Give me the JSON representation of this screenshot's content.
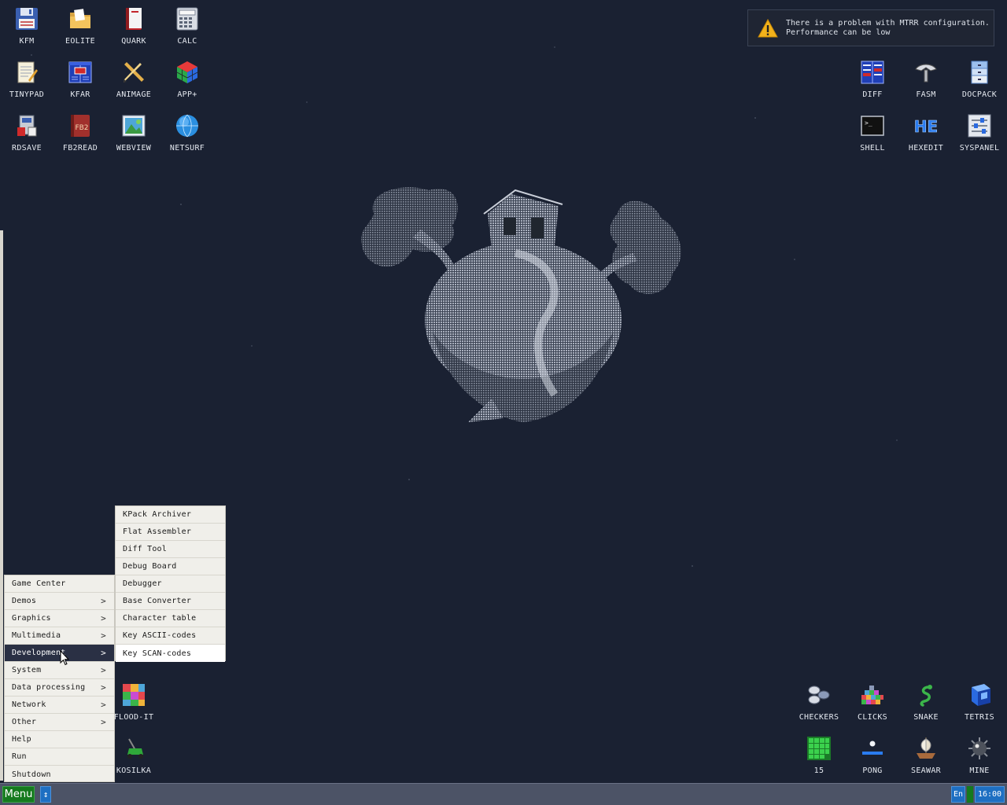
{
  "desktop": {
    "icons_top_left": [
      {
        "label": "KFM",
        "icon": "floppy-disk-icon"
      },
      {
        "label": "EOLITE",
        "icon": "folder-icon"
      },
      {
        "label": "QUARK",
        "icon": "red-book-icon"
      },
      {
        "label": "CALC",
        "icon": "calculator-icon"
      },
      {
        "label": "TINYPAD",
        "icon": "notepad-icon"
      },
      {
        "label": "KFAR",
        "icon": "blue-panels-icon"
      },
      {
        "label": "ANIMAGE",
        "icon": "pencil-ruler-icon"
      },
      {
        "label": "APP+",
        "icon": "cube-icon"
      },
      {
        "label": "RDSAVE",
        "icon": "save-drive-icon"
      },
      {
        "label": "FB2READ",
        "icon": "fb2-book-icon"
      },
      {
        "label": "WEBVIEW",
        "icon": "web-picture-icon"
      },
      {
        "label": "NETSURF",
        "icon": "globe-icon"
      }
    ],
    "icons_top_right": [
      {
        "label": "DIFF",
        "icon": "diff-icon"
      },
      {
        "label": "FASM",
        "icon": "fasm-icon"
      },
      {
        "label": "DOCPACK",
        "icon": "docpack-icon"
      },
      {
        "label": "SHELL",
        "icon": "terminal-icon"
      },
      {
        "label": "HEXEDIT",
        "icon": "hex-icon"
      },
      {
        "label": "SYSPANEL",
        "icon": "sliders-icon"
      }
    ],
    "icons_bottom_left": [
      {
        "label": "FLOOD-IT",
        "icon": "color-grid-icon"
      },
      {
        "label": "KOSILKA",
        "icon": "lawnmower-icon"
      }
    ],
    "icons_bottom_right": [
      {
        "label": "CHECKERS",
        "icon": "checkers-icon"
      },
      {
        "label": "CLICKS",
        "icon": "clicks-icon"
      },
      {
        "label": "SNAKE",
        "icon": "snake-icon"
      },
      {
        "label": "TETRIS",
        "icon": "tetris-icon"
      },
      {
        "label": "15",
        "icon": "puzzle15-icon"
      },
      {
        "label": "PONG",
        "icon": "pong-icon"
      },
      {
        "label": "SEAWAR",
        "icon": "ship-icon"
      },
      {
        "label": "MINE",
        "icon": "mine-icon"
      }
    ]
  },
  "notification": {
    "line1": "There is a problem with MTRR configuration.",
    "line2": "Performance can be low"
  },
  "main_menu": {
    "items": [
      {
        "label": "Game Center",
        "arrow": ""
      },
      {
        "label": "Demos",
        "arrow": ">"
      },
      {
        "label": "Graphics",
        "arrow": ">"
      },
      {
        "label": "Multimedia",
        "arrow": ">"
      },
      {
        "label": "Development",
        "arrow": ">"
      },
      {
        "label": "System",
        "arrow": ">"
      },
      {
        "label": "Data processing",
        "arrow": ">"
      },
      {
        "label": "Network",
        "arrow": ">"
      },
      {
        "label": "Other",
        "arrow": ">"
      },
      {
        "label": "Help",
        "arrow": ""
      },
      {
        "label": "Run",
        "arrow": ""
      },
      {
        "label": "Shutdown",
        "arrow": ""
      }
    ]
  },
  "sub_menu": {
    "items": [
      "KPack Archiver",
      "Flat Assembler",
      "Diff Tool",
      "Debug Board",
      "Debugger",
      "Base Converter",
      "Character table",
      "Key ASCII-codes",
      "Key SCAN-codes"
    ]
  },
  "taskbar": {
    "menu_label": "Menu",
    "switch_glyph": "↕",
    "lang": "En",
    "clock": "16:00"
  },
  "colors": {
    "desktop_bg": "#1a2132",
    "menu_bg": "#f0efea",
    "menu_active": "#2a3044",
    "taskbar_bg": "#4c5366",
    "menu_button": "#157a1e",
    "tray_blue": "#1e6fc2"
  }
}
